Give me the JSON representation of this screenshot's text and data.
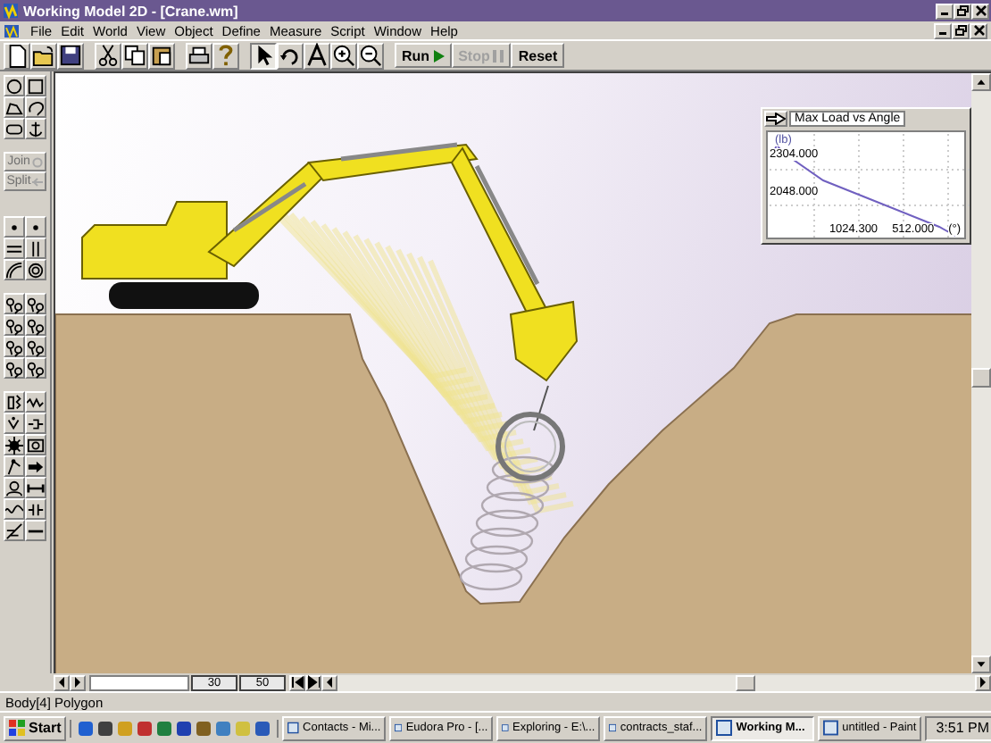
{
  "window": {
    "title": "Working Model 2D - [Crane.wm]"
  },
  "menu": [
    "File",
    "Edit",
    "World",
    "View",
    "Object",
    "Define",
    "Measure",
    "Script",
    "Window",
    "Help"
  ],
  "tools": [
    {
      "kind": "pointer",
      "selected": true
    },
    {
      "kind": "rotate",
      "selected": false
    },
    {
      "kind": "text",
      "selected": false
    },
    {
      "kind": "zoom_in",
      "selected": false
    },
    {
      "kind": "zoom_out",
      "selected": false
    }
  ],
  "run_buttons": [
    {
      "kind": "run",
      "label": "Run",
      "disabled": false
    },
    {
      "kind": "stop",
      "label": "Stop",
      "disabled": true
    },
    {
      "kind": "reset",
      "label": "Reset",
      "disabled": false
    }
  ],
  "toolbox": {
    "buttons": [
      {
        "kind": "join",
        "label": "Join",
        "disabled": true
      },
      {
        "kind": "split",
        "label": "Split",
        "disabled": true
      }
    ]
  },
  "graph": {
    "title": "Max Load vs Angle",
    "y_unit": "(lb)",
    "y_ticks": [
      "2304.000",
      "2048.000"
    ],
    "x_ticks": [
      "1024.300",
      "512.000"
    ],
    "x_unit": "(°)"
  },
  "tape": {
    "frames": [
      "30",
      "50"
    ]
  },
  "status_bar": "Body[4] Polygon",
  "taskbar": {
    "start": "Start",
    "tasks": [
      {
        "label": "Contacts - Mi...",
        "selected": false
      },
      {
        "label": "Eudora Pro - [...",
        "selected": false
      },
      {
        "label": "Exploring - E:\\...",
        "selected": false
      },
      {
        "label": "contracts_staf...",
        "selected": false
      },
      {
        "label": "Working M...",
        "selected": true
      },
      {
        "label": "untitled - Paint",
        "selected": false
      }
    ],
    "clock": "3:51 PM"
  }
}
